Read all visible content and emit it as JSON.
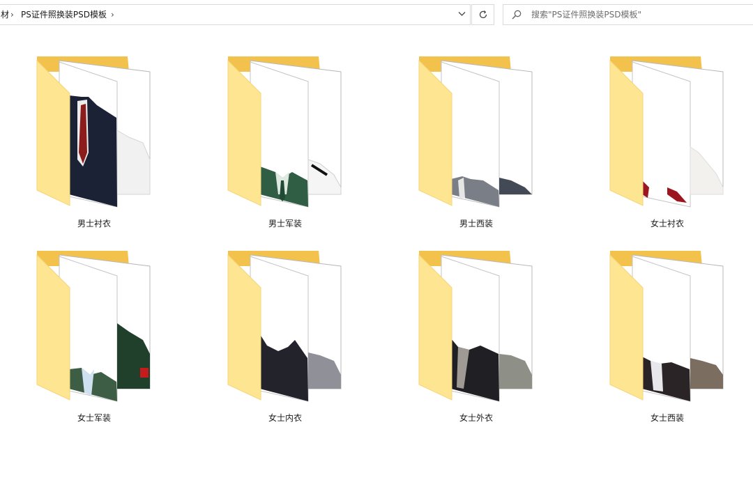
{
  "address_bar": {
    "crumbs": [
      "材",
      "PS证件照换装PSD模板"
    ],
    "separator": "›",
    "dropdown_icon": "chevron-down-icon"
  },
  "refresh_icon": "refresh-icon",
  "search": {
    "placeholder": "搜索\"PS证件照换装PSD模板\"",
    "icon": "search-icon"
  },
  "folders": [
    {
      "label": "男士衬衣",
      "clothes": "shirt-suit"
    },
    {
      "label": "男士军装",
      "clothes": "army-green"
    },
    {
      "label": "男士西装",
      "clothes": "grey-suit"
    },
    {
      "label": "女士衬衣",
      "clothes": "red-shirt"
    },
    {
      "label": "女士军装",
      "clothes": "army-dark"
    },
    {
      "label": "女士内衣",
      "clothes": "dark-inner"
    },
    {
      "label": "女士外衣",
      "clothes": "coat"
    },
    {
      "label": "女士西装",
      "clothes": "lady-suit"
    }
  ],
  "colors": {
    "folder_back": "#f2c24d",
    "folder_front": "#fde592",
    "folder_front_edge": "#f6d577",
    "border": "#d9d9d9"
  }
}
